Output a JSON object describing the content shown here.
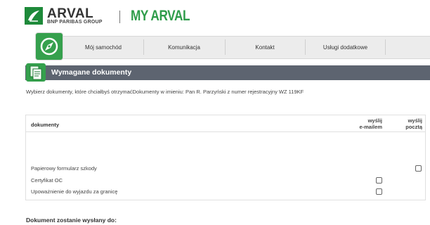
{
  "brand": {
    "name": "ARVAL",
    "sub": "BNP PARIBAS GROUP",
    "app_title": "MY ARVAL"
  },
  "nav": {
    "items": [
      {
        "label": "Mój samochód"
      },
      {
        "label": "Komunikacja"
      },
      {
        "label": "Kontakt"
      },
      {
        "label": "Usługi dodatkowe"
      }
    ]
  },
  "section": {
    "title": "Wymagane dokumenty",
    "intro": "Wybierz dokumenty, które chciałbyś otrzymaćDokumenty w imieniu: Pan R. Parzyński  z numer rejestracyjny WZ 119KF"
  },
  "table": {
    "col_doc": "dokumenty",
    "col_email_1": "wyślij",
    "col_email_2": "e-mailem",
    "col_post_1": "wyślij",
    "col_post_2": "pocztą",
    "rows": [
      {
        "label": "Papierowy formularz szkody",
        "email": false,
        "post": false
      },
      {
        "label": "Certyfikat OC",
        "email": false
      },
      {
        "label": "Upoważnienie do wyjazdu za granicę",
        "email": false
      }
    ]
  },
  "footer": {
    "title": "Dokument zostanie wysłany do:"
  },
  "colors": {
    "brand_green": "#2e9c4a",
    "section_bar": "#5d6470",
    "nav_bg": "#ececec"
  }
}
